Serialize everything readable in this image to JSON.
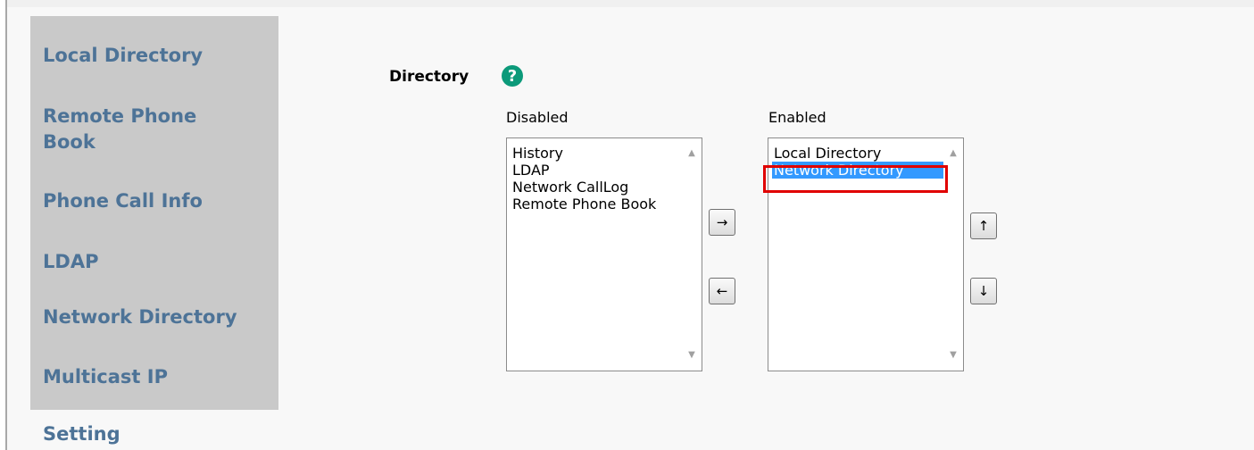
{
  "sidebar": {
    "items": [
      {
        "label": "Local Directory"
      },
      {
        "label": "Remote Phone Book"
      },
      {
        "label": "Phone Call Info"
      },
      {
        "label": "LDAP"
      },
      {
        "label": "Network Directory"
      },
      {
        "label": "Multicast IP"
      },
      {
        "label": "Setting",
        "active": true
      }
    ]
  },
  "directory": {
    "label": "Directory",
    "help_icon": "question-mark",
    "disabled_label": "Disabled",
    "enabled_label": "Enabled",
    "disabled_items": [
      "History",
      "LDAP",
      "Network CallLog",
      "Remote Phone Book"
    ],
    "enabled_items": [
      "Local Directory",
      "Network Directory"
    ],
    "selected_enabled_item": "Network Directory",
    "buttons": {
      "move_right": "→",
      "move_left": "←",
      "move_up": "↑",
      "move_down": "↓"
    }
  },
  "colors": {
    "sidebar_text": "#4d7397",
    "sidebar_bg": "#c9c9c9",
    "help_icon": "#0c9a7a",
    "selection": "#3399ff",
    "highlight_border": "#e00000"
  }
}
